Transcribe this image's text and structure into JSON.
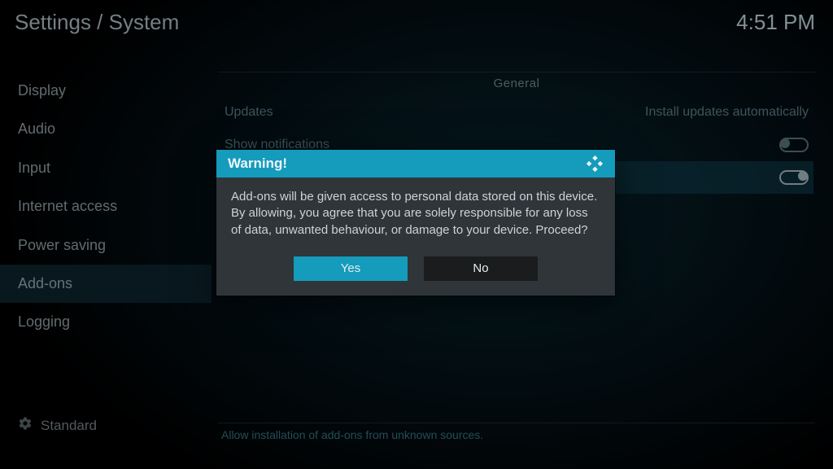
{
  "header": {
    "breadcrumb": "Settings / System",
    "clock": "4:51 PM"
  },
  "sidebar": {
    "items": [
      {
        "label": "Display"
      },
      {
        "label": "Audio"
      },
      {
        "label": "Input"
      },
      {
        "label": "Internet access"
      },
      {
        "label": "Power saving"
      },
      {
        "label": "Add-ons",
        "active": true
      },
      {
        "label": "Logging"
      }
    ],
    "level_label": "Standard"
  },
  "main": {
    "section_title": "General",
    "rows": {
      "updates": {
        "label": "Updates",
        "value": "Install updates automatically"
      },
      "notif": {
        "label": "Show notifications",
        "on": false
      },
      "unknown": {
        "label": "",
        "on": true
      }
    },
    "footer": "Allow installation of add-ons from unknown sources."
  },
  "dialog": {
    "title": "Warning!",
    "body": "Add-ons will be given access to personal data stored on this device. By allowing, you agree that you are solely responsible for any loss of data, unwanted behaviour, or damage to your device. Proceed?",
    "yes": "Yes",
    "no": "No"
  }
}
